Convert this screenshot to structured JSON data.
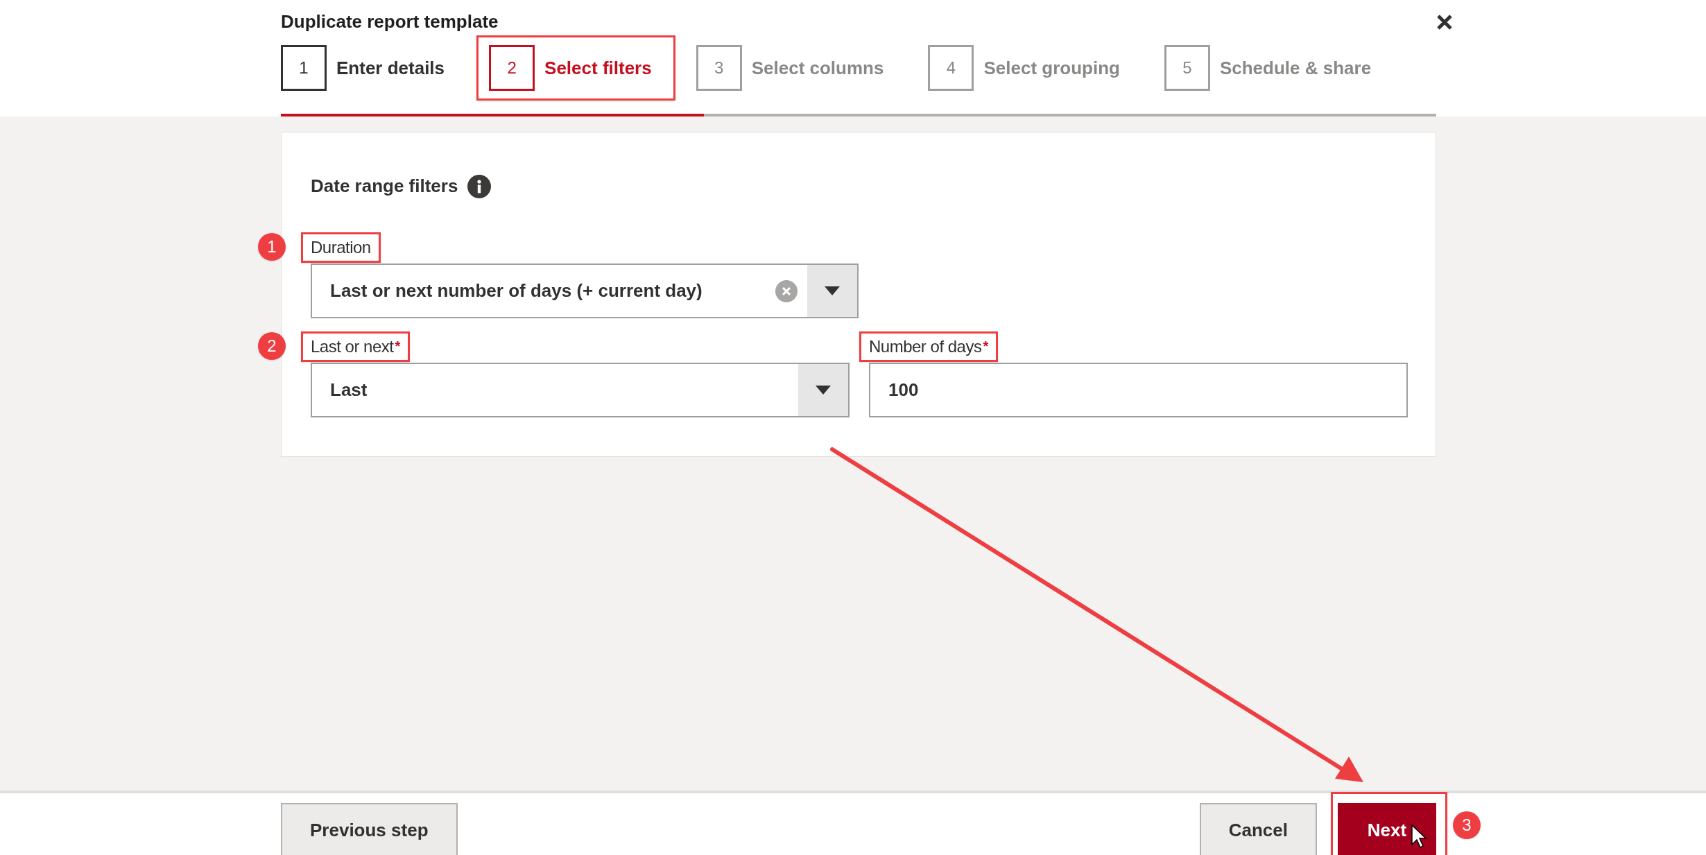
{
  "dialog": {
    "title": "Duplicate report template"
  },
  "steps": [
    {
      "number": "1",
      "label": "Enter details",
      "selected": false,
      "completed": true,
      "highlighted": false
    },
    {
      "number": "2",
      "label": "Select filters",
      "selected": true,
      "completed": false,
      "highlighted": true
    },
    {
      "number": "3",
      "label": "Select columns",
      "selected": false,
      "completed": false,
      "highlighted": false
    },
    {
      "number": "4",
      "label": "Select grouping",
      "selected": false,
      "completed": false,
      "highlighted": false
    },
    {
      "number": "5",
      "label": "Schedule & share",
      "selected": false,
      "completed": false,
      "highlighted": false
    }
  ],
  "progress": {
    "level": 0.366
  },
  "section": {
    "title": "Date range filters"
  },
  "fields": [
    {
      "kind": "select",
      "label": "Duration",
      "value": "Last or next number of days (+ current day)",
      "clearable": true,
      "highlighted": true,
      "callout": "1"
    },
    {
      "kind": "select",
      "label": "Last or next",
      "required_mark": "*",
      "value": "Last",
      "clearable": false,
      "highlighted": true,
      "callout": "2"
    },
    {
      "kind": "text",
      "label": "Number of days",
      "required_mark": "*",
      "value": "100",
      "highlighted": true
    }
  ],
  "footer": {
    "buttons": [
      {
        "label": "Previous step",
        "kind": "secondary",
        "highlighted": false
      },
      {
        "label": "Cancel",
        "kind": "secondary",
        "highlighted": false
      },
      {
        "label": "Next",
        "kind": "primary",
        "highlighted": true,
        "callout": "3"
      }
    ]
  }
}
